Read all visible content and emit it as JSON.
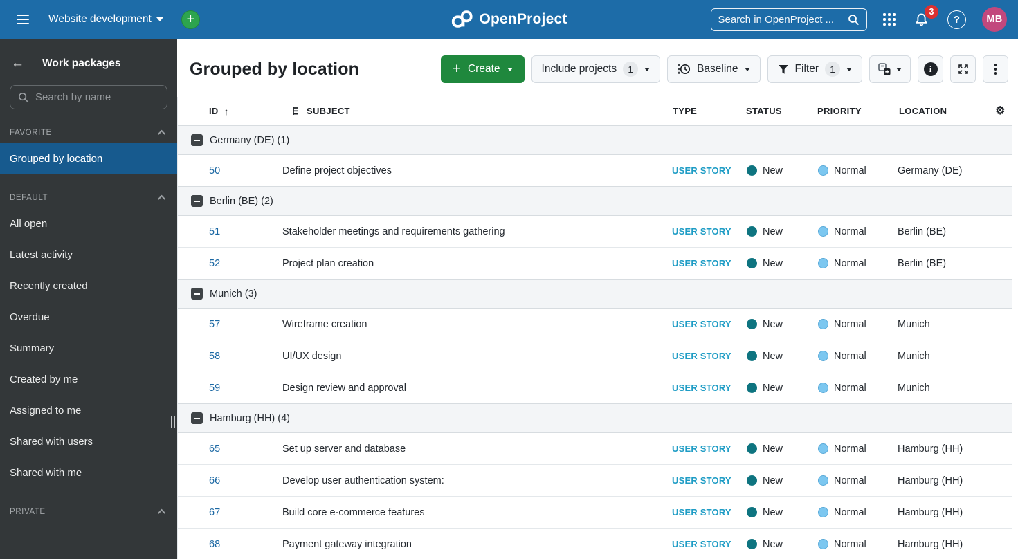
{
  "topbar": {
    "project_selector_label": "Website development",
    "logo_text": "OpenProject",
    "search_placeholder": "Search in OpenProject ...",
    "notification_count": "3",
    "avatar_initials": "MB"
  },
  "sidebar": {
    "title": "Work packages",
    "search_placeholder": "Search by name",
    "sections": [
      {
        "label": "FAVORITE",
        "items": [
          {
            "label": "Grouped by location",
            "selected": true
          }
        ]
      },
      {
        "label": "DEFAULT",
        "items": [
          {
            "label": "All open"
          },
          {
            "label": "Latest activity"
          },
          {
            "label": "Recently created"
          },
          {
            "label": "Overdue"
          },
          {
            "label": "Summary"
          },
          {
            "label": "Created by me"
          },
          {
            "label": "Assigned to me"
          },
          {
            "label": "Shared with users"
          },
          {
            "label": "Shared with me"
          }
        ]
      },
      {
        "label": "PRIVATE",
        "items": []
      }
    ]
  },
  "toolbar": {
    "page_title": "Grouped by location",
    "create_button_label": "Create",
    "include_projects_label": "Include projects",
    "include_projects_count": "1",
    "baseline_label": "Baseline",
    "filter_label": "Filter",
    "filter_count": "1"
  },
  "table": {
    "columns": {
      "id": "ID",
      "subject": "SUBJECT",
      "type": "TYPE",
      "status": "STATUS",
      "priority": "PRIORITY",
      "location": "LOCATION"
    },
    "groups": [
      {
        "label": "Germany (DE) (1)",
        "rows": [
          {
            "id": "50",
            "subject": "Define project objectives",
            "type": "USER STORY",
            "status": "New",
            "priority": "Normal",
            "location": "Germany (DE)"
          }
        ]
      },
      {
        "label": "Berlin (BE) (2)",
        "rows": [
          {
            "id": "51",
            "subject": "Stakeholder meetings and requirements gathering",
            "type": "USER STORY",
            "status": "New",
            "priority": "Normal",
            "location": "Berlin (BE)"
          },
          {
            "id": "52",
            "subject": "Project plan creation",
            "type": "USER STORY",
            "status": "New",
            "priority": "Normal",
            "location": "Berlin (BE)"
          }
        ]
      },
      {
        "label": "Munich (3)",
        "rows": [
          {
            "id": "57",
            "subject": "Wireframe creation",
            "type": "USER STORY",
            "status": "New",
            "priority": "Normal",
            "location": "Munich"
          },
          {
            "id": "58",
            "subject": "UI/UX design",
            "type": "USER STORY",
            "status": "New",
            "priority": "Normal",
            "location": "Munich"
          },
          {
            "id": "59",
            "subject": "Design review and approval",
            "type": "USER STORY",
            "status": "New",
            "priority": "Normal",
            "location": "Munich"
          }
        ]
      },
      {
        "label": "Hamburg (HH) (4)",
        "rows": [
          {
            "id": "65",
            "subject": "Set up server and database",
            "type": "USER STORY",
            "status": "New",
            "priority": "Normal",
            "location": "Hamburg (HH)"
          },
          {
            "id": "66",
            "subject": "Develop user authentication system:",
            "type": "USER STORY",
            "status": "New",
            "priority": "Normal",
            "location": "Hamburg (HH)"
          },
          {
            "id": "67",
            "subject": "Build core e-commerce features",
            "type": "USER STORY",
            "status": "New",
            "priority": "Normal",
            "location": "Hamburg (HH)"
          },
          {
            "id": "68",
            "subject": "Payment gateway integration",
            "type": "USER STORY",
            "status": "New",
            "priority": "Normal",
            "location": "Hamburg (HH)"
          }
        ]
      }
    ]
  },
  "icons": {
    "back_arrow": "←",
    "sort_ascending": "↑",
    "gear": "⚙",
    "help": "?",
    "info": "i"
  },
  "colors": {
    "topbar_background": "#1D6CA8",
    "sidebar_background": "#333739",
    "sidebar_selected": "#175A8E",
    "create_button_green": "#1F883D",
    "type_user_story": "#1E9CC5",
    "status_new_dot": "#0E7480",
    "priority_normal_dot": "#7CC7F0",
    "id_link": "#1A67A3",
    "notification_badge": "#DC3030",
    "avatar_background": "#C2487D"
  }
}
